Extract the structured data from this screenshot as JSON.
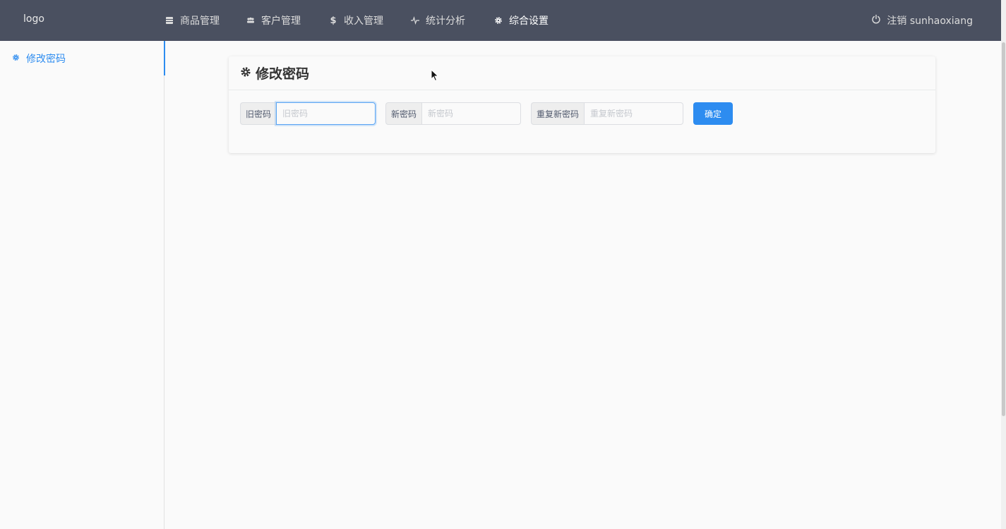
{
  "header": {
    "logo": "logo",
    "nav": [
      {
        "label": "商品管理",
        "icon": "list-icon"
      },
      {
        "label": "客户管理",
        "icon": "people-icon"
      },
      {
        "label": "收入管理",
        "icon": "dollar-icon"
      },
      {
        "label": "统计分析",
        "icon": "pulse-icon"
      },
      {
        "label": "综合设置",
        "icon": "gear-icon"
      }
    ],
    "active_nav": "综合设置",
    "logout_label": "注销 sunhaoxiang"
  },
  "sidebar": {
    "items": [
      {
        "label": "修改密码",
        "icon": "gear-icon"
      }
    ]
  },
  "card": {
    "title": "修改密码"
  },
  "form": {
    "old_label": "旧密码",
    "old_placeholder": "旧密码",
    "old_value": "",
    "new_label": "新密码",
    "new_placeholder": "新密码",
    "new_value": "",
    "repeat_label": "重复新密码",
    "repeat_placeholder": "重复新密码",
    "repeat_value": "",
    "submit_label": "确定"
  },
  "colors": {
    "header_bg": "#4a5060",
    "accent": "#2d8cf0"
  }
}
